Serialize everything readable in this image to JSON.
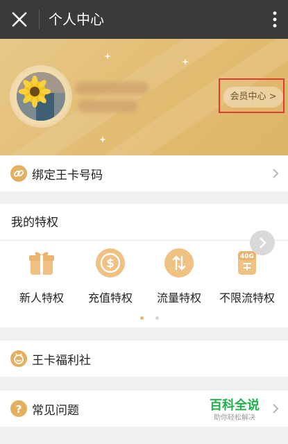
{
  "topbar": {
    "title": "个人中心",
    "icons": [
      "close-icon",
      "more-vertical-icon"
    ]
  },
  "profile": {
    "member_button": "会员中心 >"
  },
  "bind_card": {
    "label": "绑定王卡号码",
    "icon": "link-icon"
  },
  "privileges": {
    "heading": "我的特权",
    "items": [
      {
        "label": "新人特权",
        "icon": "gift-icon"
      },
      {
        "label": "充值特权",
        "icon": "dollar-coin-icon"
      },
      {
        "label": "流量特权",
        "icon": "up-down-arrows-icon"
      },
      {
        "label": "不限流特权",
        "icon": "unlimited-40g-icon",
        "badge": "40G"
      }
    ],
    "page_count": 2,
    "active_page": 1
  },
  "benefits": {
    "label": "王卡福利社",
    "icon": "smile-badge-icon"
  },
  "faq": {
    "label": "常见问题",
    "icon": "question-icon"
  },
  "watermark": {
    "main": "百科全说",
    "sub": "助你轻松解决"
  },
  "colors": {
    "topbar": "#3a3a3d",
    "hero_gold": "#e3bd74",
    "accent_icon": "#e3b05f",
    "highlight_box": "#e23b31",
    "watermark_green": "#21b14b"
  }
}
